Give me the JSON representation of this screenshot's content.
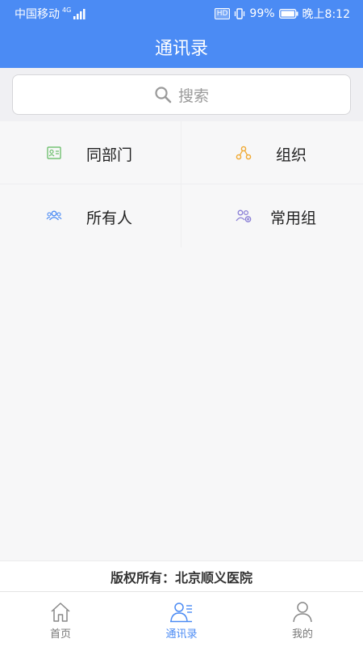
{
  "status_bar": {
    "carrier": "中国移动",
    "network": "4G",
    "hd": "HD",
    "battery": "99%",
    "time": "晚上8:12"
  },
  "header": {
    "title": "通讯录"
  },
  "search": {
    "placeholder": "搜索",
    "icon": "search-icon"
  },
  "menu": [
    {
      "label": "同部门",
      "icon": "id-card-icon",
      "color": "#5cb85c"
    },
    {
      "label": "组织",
      "icon": "org-chart-icon",
      "color": "#f0a830"
    },
    {
      "label": "所有人",
      "icon": "users-icon",
      "color": "#4b8bf4"
    },
    {
      "label": "常用组",
      "icon": "group-icon",
      "color": "#8a7fd6"
    }
  ],
  "footer": {
    "copyright": "版权所有：北京顺义医院"
  },
  "tabs": [
    {
      "label": "首页",
      "icon": "home-icon",
      "active": false
    },
    {
      "label": "通讯录",
      "icon": "contacts-icon",
      "active": true
    },
    {
      "label": "我的",
      "icon": "user-icon",
      "active": false
    }
  ],
  "colors": {
    "primary": "#4b8bf4",
    "background": "#f7f7f8"
  }
}
